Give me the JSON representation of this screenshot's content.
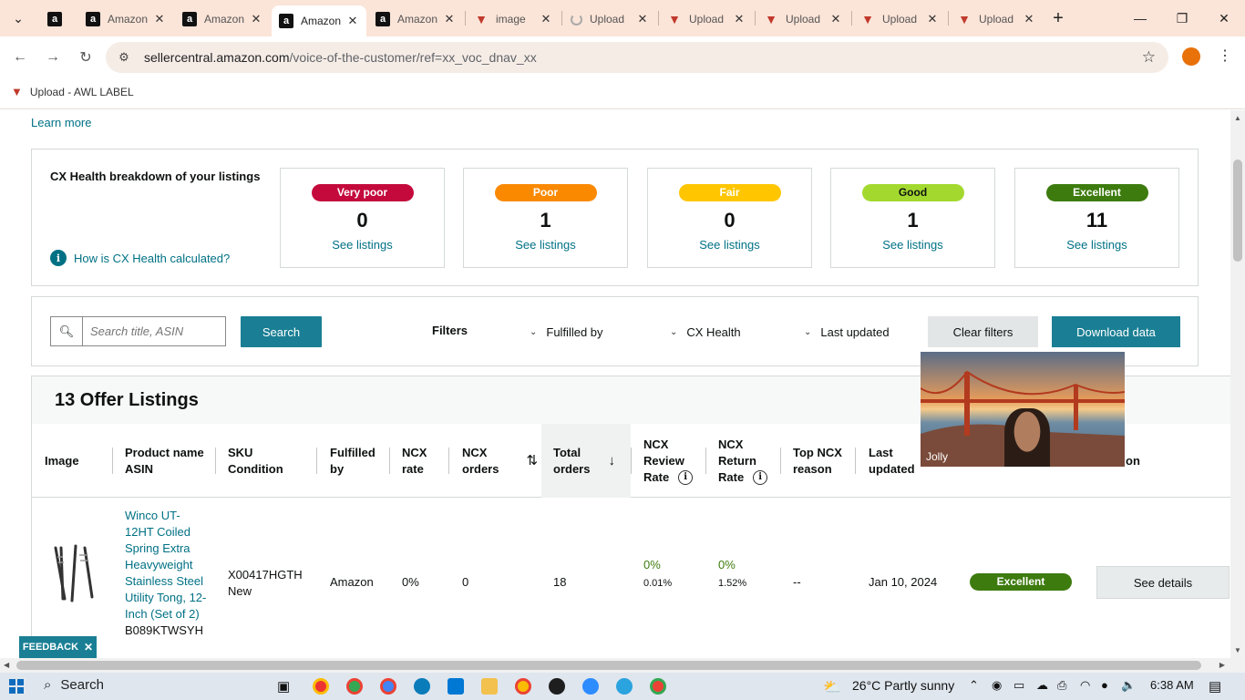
{
  "browser": {
    "tabs": [
      {
        "label": "",
        "icon": "amazon-icon"
      },
      {
        "label": "Amazon",
        "icon": "amazon-icon"
      },
      {
        "label": "Amazon",
        "icon": "amazon-icon"
      },
      {
        "label": "Amazon",
        "icon": "amazon-icon",
        "active": true
      },
      {
        "label": "Amazon",
        "icon": "amazon-icon"
      },
      {
        "label": "image",
        "icon": "awl-icon"
      },
      {
        "label": "Upload",
        "icon": "loading-icon"
      },
      {
        "label": "Upload",
        "icon": "awl-icon"
      },
      {
        "label": "Upload",
        "icon": "awl-icon"
      },
      {
        "label": "Upload",
        "icon": "awl-icon"
      },
      {
        "label": "Upload",
        "icon": "awl-icon"
      }
    ],
    "url_host": "sellercentral.amazon.com",
    "url_path": "/voice-of-the-customer/ref=xx_voc_dnav_xx",
    "bookmark": "Upload - AWL LABEL"
  },
  "page": {
    "learn_more": "Learn more",
    "health": {
      "title": "CX Health breakdown of your listings",
      "how_link": "How is CX Health calculated?",
      "cards": [
        {
          "label": "Very poor",
          "count": "0",
          "see": "See listings",
          "color": "#c40a3c",
          "text": "#ffffff"
        },
        {
          "label": "Poor",
          "count": "1",
          "see": "See listings",
          "color": "#fa8900",
          "text": "#ffffff"
        },
        {
          "label": "Fair",
          "count": "0",
          "see": "See listings",
          "color": "#ffc600",
          "text": "#ffffff"
        },
        {
          "label": "Good",
          "count": "1",
          "see": "See listings",
          "color": "#a3d92f",
          "text": "#0f1111"
        },
        {
          "label": "Excellent",
          "count": "11",
          "see": "See listings",
          "color": "#3d7b0e",
          "text": "#ffffff"
        }
      ]
    },
    "filters": {
      "search_placeholder": "Search title, ASIN",
      "search_button": "Search",
      "filters_label": "Filters",
      "fulfilled_by": "Fulfilled by",
      "cx_health": "CX Health",
      "last_updated": "Last updated",
      "clear": "Clear filters",
      "download": "Download data"
    },
    "listings": {
      "title": "13 Offer Listings",
      "headers": {
        "image": "Image",
        "product_1": "Product name",
        "product_2": "ASIN",
        "sku_1": "SKU",
        "sku_2": "Condition",
        "fulfilled_1": "Fulfilled",
        "fulfilled_2": "by",
        "ncx_rate_1": "NCX",
        "ncx_rate_2": "rate",
        "ncx_orders_1": "NCX",
        "ncx_orders_2": "orders",
        "total_1": "Total",
        "total_2": "orders",
        "review_1": "NCX",
        "review_2": "Review",
        "review_3": "Rate",
        "return_1": "NCX",
        "return_2": "Return",
        "return_3": "Rate",
        "reason_1": "Top NCX",
        "reason_2": "reason",
        "updated_1": "Last",
        "updated_2": "updated",
        "action_tail": "on"
      },
      "rows": [
        {
          "product": "Winco UT-12HT Coiled Spring Extra Heavyweight Stainless Steel Utility Tong, 12-Inch (Set of 2)",
          "asin": "B089KTWSYH",
          "sku": "X00417HGTH",
          "condition": "New",
          "fulfilled_by": "Amazon",
          "ncx_rate": "0%",
          "ncx_orders": "0",
          "total_orders": "18",
          "review_rate": "0%",
          "review_sub": "0.01%",
          "return_rate": "0%",
          "return_sub": "1.52%",
          "top_reason": "--",
          "last_updated": "Jan 10, 2024",
          "cx_health": "Excellent",
          "action": "See details"
        }
      ]
    },
    "feedback": "FEEDBACK"
  },
  "video": {
    "name": "Jolly"
  },
  "taskbar": {
    "search": "Search",
    "weather": "26°C  Partly sunny",
    "time": "6:38 AM"
  }
}
